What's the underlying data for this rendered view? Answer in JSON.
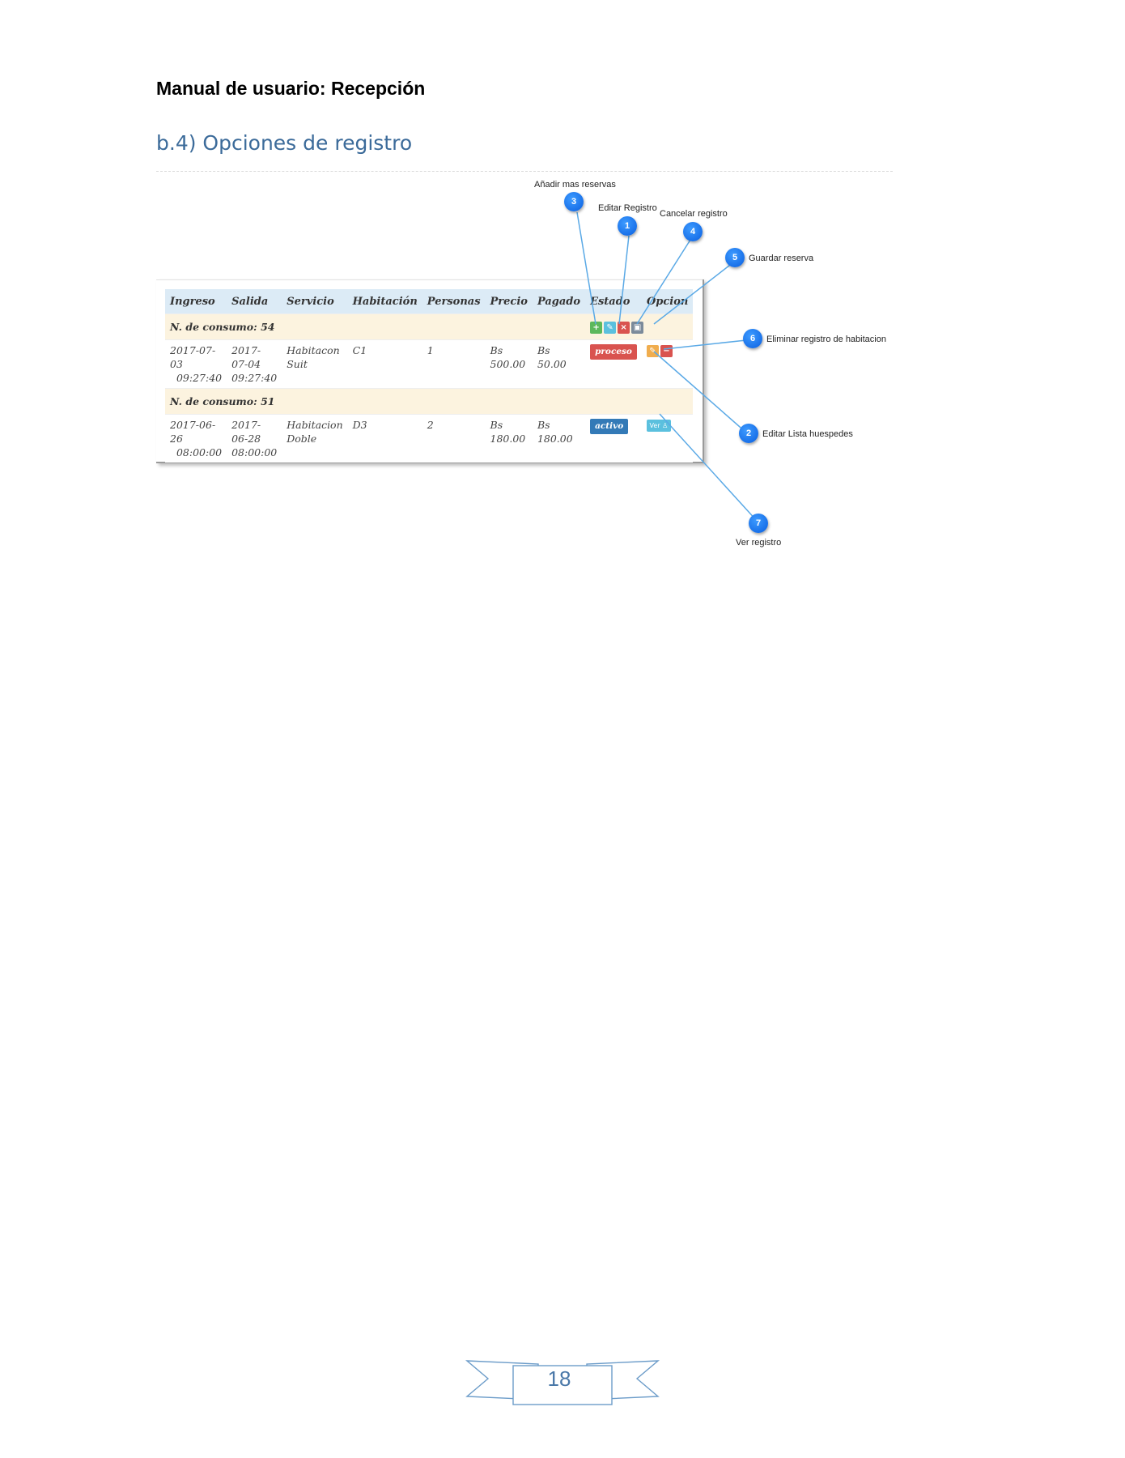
{
  "document": {
    "header": "Manual de usuario: Recepción",
    "section_title": "b.4) Opciones de registro",
    "page_number": "18"
  },
  "table": {
    "columns": [
      "Ingreso",
      "Salida",
      "Servicio",
      "Habitación",
      "Personas",
      "Precio",
      "Pagado",
      "Estado",
      "Opcion"
    ],
    "groups": [
      {
        "label": "N. de consumo: 54",
        "actions": [
          "plus-icon",
          "edit-icon",
          "close-icon",
          "save-icon"
        ],
        "rows": [
          {
            "ingreso": [
              "2017-07-03",
              "09:27:40"
            ],
            "salida": [
              "2017-07-04",
              "09:27:40"
            ],
            "servicio": [
              "Habitacon",
              "Suit"
            ],
            "habitacion": "C1",
            "personas": "1",
            "precio": [
              "Bs",
              "500.00"
            ],
            "pagado": [
              "Bs",
              "50.00"
            ],
            "estado": "proceso",
            "opciones": [
              "edit-icon",
              "minus-icon"
            ]
          }
        ]
      },
      {
        "label": "N. de consumo: 51",
        "rows": [
          {
            "ingreso": [
              "2017-06-26",
              "08:00:00"
            ],
            "salida": [
              "2017-06-28",
              "08:00:00"
            ],
            "servicio": [
              "Habitacion",
              "Doble"
            ],
            "habitacion": "D3",
            "personas": "2",
            "precio": [
              "Bs",
              "180.00"
            ],
            "pagado": [
              "Bs",
              "180.00"
            ],
            "estado": "activo",
            "opciones": [
              "Ver"
            ]
          }
        ]
      }
    ]
  },
  "callouts": [
    {
      "number": "3",
      "label": "Añadir mas reservas"
    },
    {
      "number": "1",
      "label": "Editar Registro"
    },
    {
      "number": "4",
      "label": "Cancelar registro"
    },
    {
      "number": "5",
      "label": "Guardar reserva"
    },
    {
      "number": "6",
      "label": "Eliminar registro de habitacion"
    },
    {
      "number": "2",
      "label": "Editar Lista huespedes"
    },
    {
      "number": "7",
      "label": "Ver registro"
    }
  ],
  "colors": {
    "title_blue": "#3c6b9a",
    "header_row": "#dcebf6",
    "group_row": "#fcf3df",
    "marker_blue": "#0a5fe0",
    "line_blue": "#5aa9e6"
  }
}
